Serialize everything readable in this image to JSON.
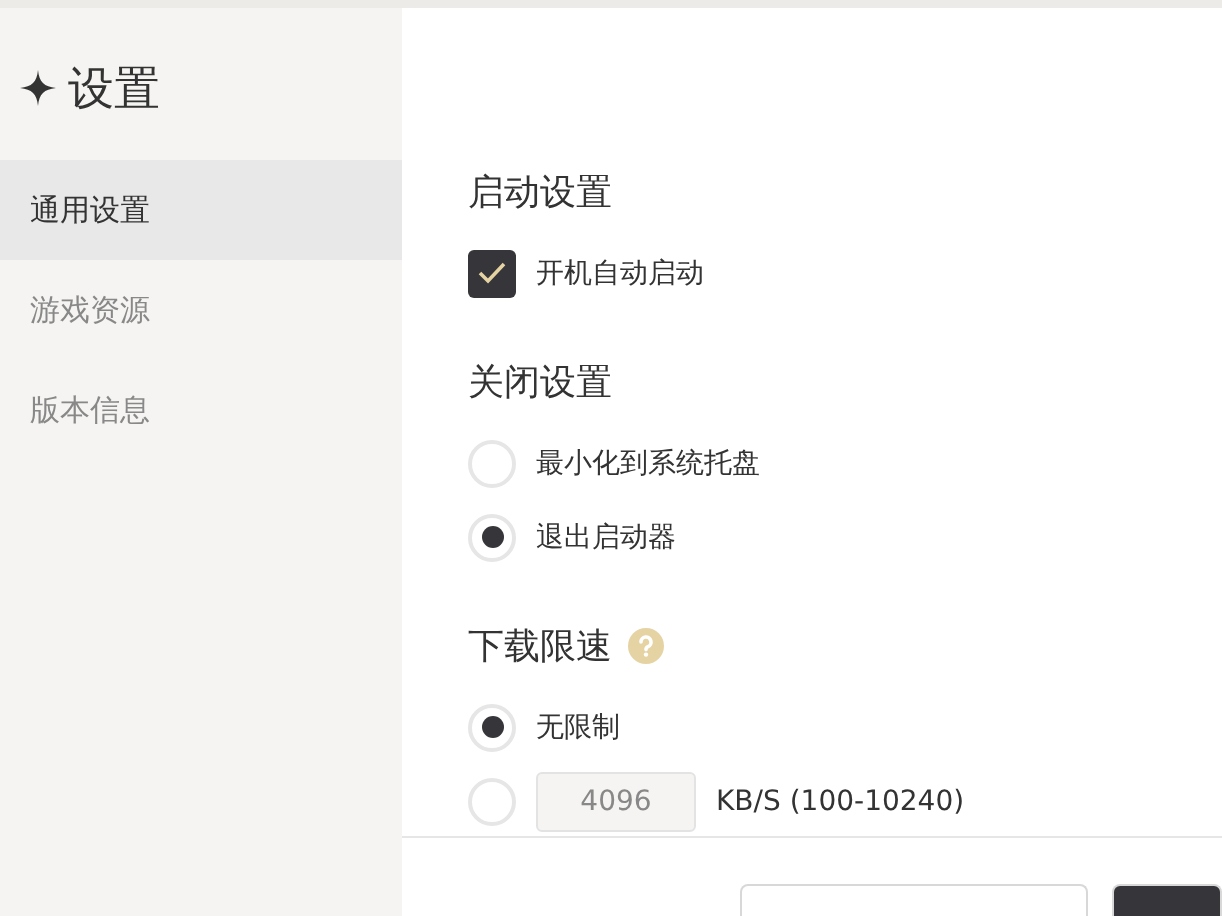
{
  "sidebar": {
    "title": "设置",
    "items": [
      {
        "label": "通用设置",
        "selected": true
      },
      {
        "label": "游戏资源",
        "selected": false
      },
      {
        "label": "版本信息",
        "selected": false
      }
    ]
  },
  "sections": [
    {
      "title": "启动设置",
      "kind": "checkbox",
      "options": [
        {
          "label": "开机自动启动",
          "checked": true
        }
      ]
    },
    {
      "title": "关闭设置",
      "kind": "radio",
      "options": [
        {
          "label": "最小化到系统托盘",
          "selected": false
        },
        {
          "label": "退出启动器",
          "selected": true
        }
      ]
    },
    {
      "title": "下载限速",
      "kind": "radio",
      "help": true,
      "options": [
        {
          "label": "无限制",
          "selected": true
        },
        {
          "kind": "custom",
          "value": "4096",
          "label": "KB/S (100-10240)",
          "selected": false
        }
      ]
    }
  ]
}
